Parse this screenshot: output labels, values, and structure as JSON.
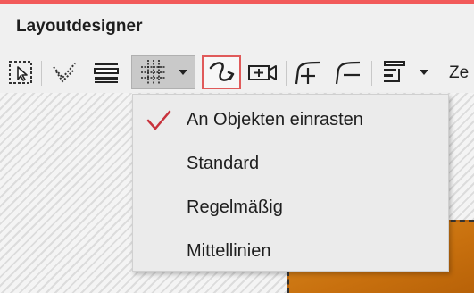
{
  "colors": {
    "window_accent": "#f25a5a",
    "active_tool_border": "#e05a5a",
    "check_mark": "#c8323c",
    "canvas_object": "#d07a14"
  },
  "window": {
    "title": "Layoutdesigner"
  },
  "toolbar": {
    "tools": [
      {
        "icon": "selection-arrow-icon",
        "active": false
      },
      {
        "icon": "guide-lines-icon",
        "active": false
      },
      {
        "icon": "stack-lines-icon",
        "active": false
      },
      {
        "icon": "grid-snap-icon",
        "active": true,
        "has_dropdown": true
      },
      {
        "icon": "curve-path-icon",
        "active": true
      },
      {
        "icon": "camera-icon",
        "active": false
      },
      {
        "icon": "curve-add-icon",
        "active": false
      },
      {
        "icon": "curve-remove-icon",
        "active": false
      },
      {
        "icon": "text-align-icon",
        "active": false,
        "has_dropdown": true
      }
    ],
    "overflow_label": "Ze"
  },
  "snap_menu": {
    "items": [
      {
        "label": "An Objekten einrasten",
        "checked": true
      },
      {
        "label": "Standard",
        "checked": false
      },
      {
        "label": "Regelmäßig",
        "checked": false
      },
      {
        "label": "Mittellinien",
        "checked": false
      }
    ]
  }
}
